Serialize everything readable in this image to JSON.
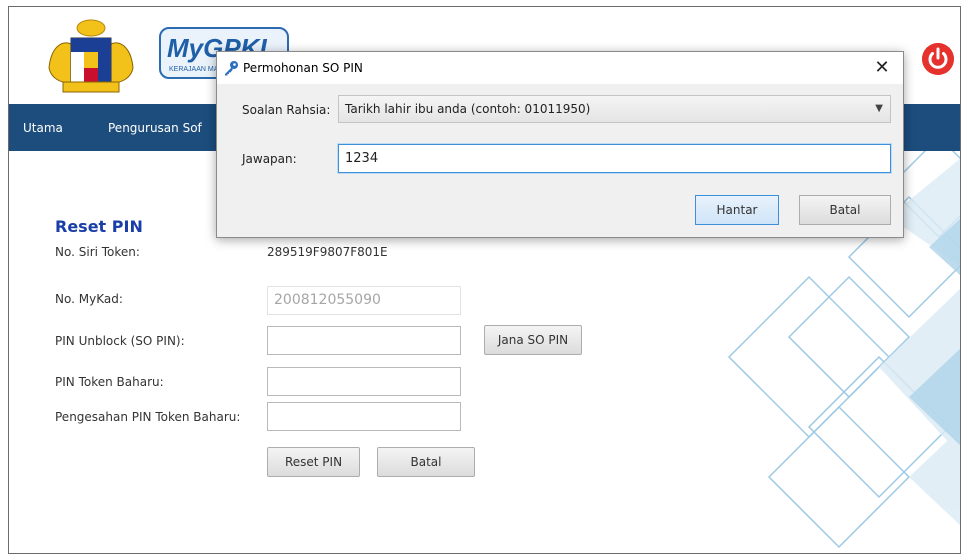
{
  "app": {
    "logo_text": "MyGPKI",
    "logo_tagline": "KERAJAAN MALAYSIA",
    "nav": {
      "items": [
        "Utama",
        "Pengurusan Sof"
      ]
    },
    "colors": {
      "nav_bg": "#1c4d7c",
      "title_blue": "#1a3ea8",
      "power_red": "#e5322d",
      "accent_blue": "#3c8fd8"
    }
  },
  "reset_form": {
    "title": "Reset PIN",
    "token_serial_label": "No. Siri Token:",
    "token_serial_value": "289519F9807F801E",
    "mykad_label": "No. MyKad:",
    "mykad_value": "200812055090",
    "so_pin_label": "PIN Unblock (SO PIN):",
    "so_pin_value": "",
    "generate_so_pin_button": "Jana SO PIN",
    "new_pin_label": "PIN Token Baharu:",
    "new_pin_value": "",
    "confirm_pin_label": "Pengesahan PIN Token Baharu:",
    "confirm_pin_value": "",
    "reset_button": "Reset PIN",
    "cancel_button": "Batal"
  },
  "dialog": {
    "icon": "key-icon",
    "title": "Permohonan SO PIN",
    "close_glyph": "✕",
    "question_label": "Soalan Rahsia:",
    "question_selected": "Tarikh lahir ibu anda (contoh: 01011950)",
    "answer_label": "Jawapan:",
    "answer_value": "1234",
    "submit_button": "Hantar",
    "cancel_button": "Batal"
  }
}
